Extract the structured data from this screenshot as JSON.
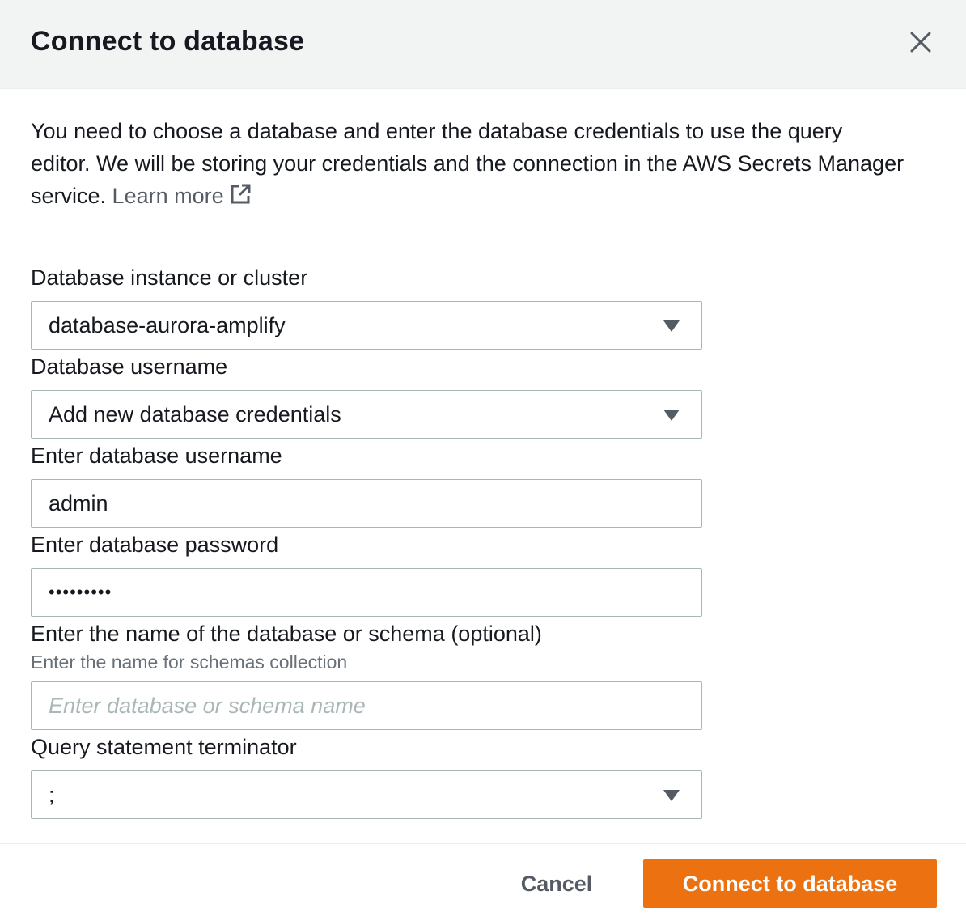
{
  "dialog": {
    "title": "Connect to database",
    "close_icon": "close-icon",
    "description": "You need to choose a database and enter the database credentials to use the query editor. We will be storing your credentials and the connection in the AWS Secrets Manager service.",
    "learn_more": "Learn more",
    "learn_more_icon": "external-link-icon"
  },
  "form": {
    "instance": {
      "label": "Database instance or cluster",
      "value": "database-aurora-amplify"
    },
    "username_select": {
      "label": "Database username",
      "value": "Add new database credentials"
    },
    "username_input": {
      "label": "Enter database username",
      "value": "admin"
    },
    "password_input": {
      "label": "Enter database password",
      "value": "•••••••••"
    },
    "schema_input": {
      "label": "Enter the name of the database or schema (optional)",
      "description": "Enter the name for schemas collection",
      "placeholder": "Enter database or schema name"
    },
    "terminator": {
      "label": "Query statement terminator",
      "value": ";"
    }
  },
  "footer": {
    "cancel_label": "Cancel",
    "connect_label": "Connect to database"
  },
  "colors": {
    "primary": "#ec7211",
    "header_bg": "#f2f3f3",
    "border": "#aab7b8",
    "link": "#545b64"
  }
}
